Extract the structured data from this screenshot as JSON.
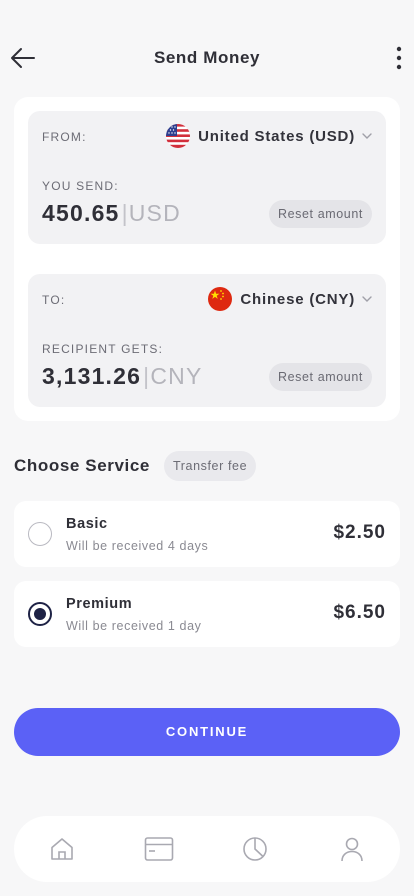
{
  "header": {
    "title": "Send Money"
  },
  "exchange": {
    "from": {
      "label": "FROM:",
      "currency": "United States (USD)",
      "amount_label": "YOU SEND:",
      "amount": "450.65",
      "separator": "|",
      "unit": "USD",
      "reset_label": "Reset amount"
    },
    "to": {
      "label": "TO:",
      "currency": "Chinese (CNY)",
      "amount_label": "RECIPIENT GETS:",
      "amount": "3,131.26",
      "separator": "|",
      "unit": "CNY",
      "reset_label": "Reset amount"
    }
  },
  "service": {
    "title": "Choose Service",
    "badge": "Transfer fee",
    "options": [
      {
        "name": "Basic",
        "desc": "Will be received 4 days",
        "price": "$2.50",
        "selected": false
      },
      {
        "name": "Premium",
        "desc": "Will be received 1 day",
        "price": "$6.50",
        "selected": true
      }
    ]
  },
  "actions": {
    "continue_label": "CONTINUE"
  },
  "nav": {
    "items": [
      "home-icon",
      "card-icon",
      "chart-icon",
      "profile-icon"
    ]
  },
  "colors": {
    "accent": "#5b61f6",
    "radio_selected": "#1e2245",
    "background": "#f7f7f8"
  }
}
